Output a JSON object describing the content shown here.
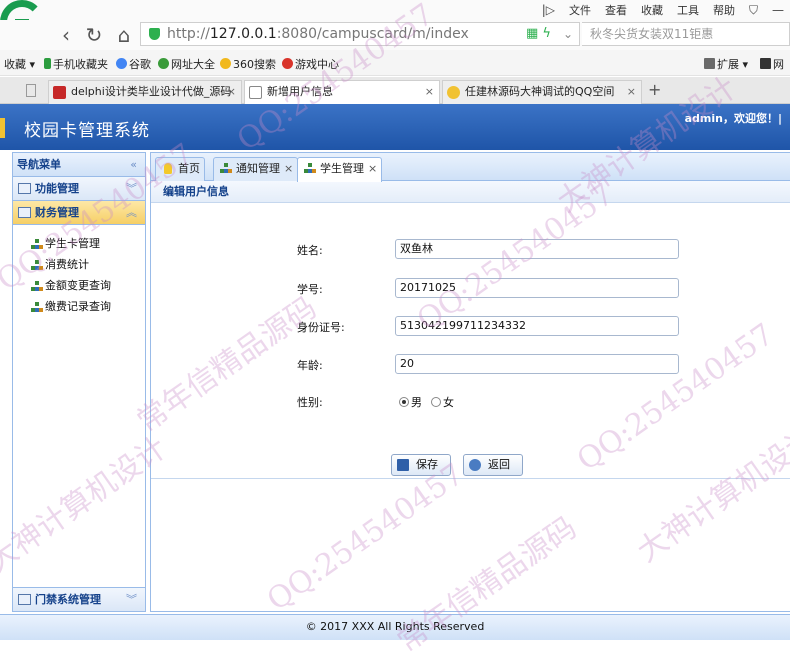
{
  "browser": {
    "menu": [
      "文件",
      "查看",
      "收藏",
      "工具",
      "帮助"
    ],
    "url_host": "127.0.0.1",
    "url_rest": ":8080/campuscard/m/index",
    "url_prefix": "http://",
    "search_placeholder": "秋冬尖货女装双11钜惠",
    "bookmarks": [
      "收藏",
      "手机收藏夹",
      "谷歌",
      "网址大全",
      "360搜索",
      "游戏中心",
      "扩展",
      "网"
    ],
    "tabs": [
      {
        "title": "delphi设计类毕业设计代做_源码"
      },
      {
        "title": "新增用户信息"
      },
      {
        "title": "任建林源码大神调试的QQ空间"
      }
    ]
  },
  "app": {
    "title": "校园卡管理系统",
    "welcome": "admin，欢迎您！|",
    "accent_color": "#1f55a8"
  },
  "sidebar": {
    "header": "导航菜单",
    "panels": [
      {
        "label": "功能管理"
      },
      {
        "label": "财务管理"
      }
    ],
    "items": [
      {
        "label": "学生卡管理"
      },
      {
        "label": "消费统计"
      },
      {
        "label": "金额变更查询"
      },
      {
        "label": "缴费记录查询"
      }
    ],
    "bottom_panel": "门禁系统管理"
  },
  "tabs": [
    {
      "label": "首页"
    },
    {
      "label": "通知管理"
    },
    {
      "label": "学生管理"
    }
  ],
  "form": {
    "title": "编辑用户信息",
    "name_label": "姓名:",
    "name_value": "双鱼林",
    "id_label": "学号:",
    "id_value": "20171025",
    "card_label": "身份证号:",
    "card_value": "513042199711234332",
    "age_label": "年龄:",
    "age_value": "20",
    "gender_label": "性别:",
    "gender_male": "男",
    "gender_female": "女",
    "save_label": "保存",
    "back_label": "返回"
  },
  "footer": "© 2017 XXX All Rights Reserved",
  "watermark": {
    "lines": [
      "QQ:254540457",
      "大神计算机设计",
      "常年信精品源码"
    ]
  }
}
